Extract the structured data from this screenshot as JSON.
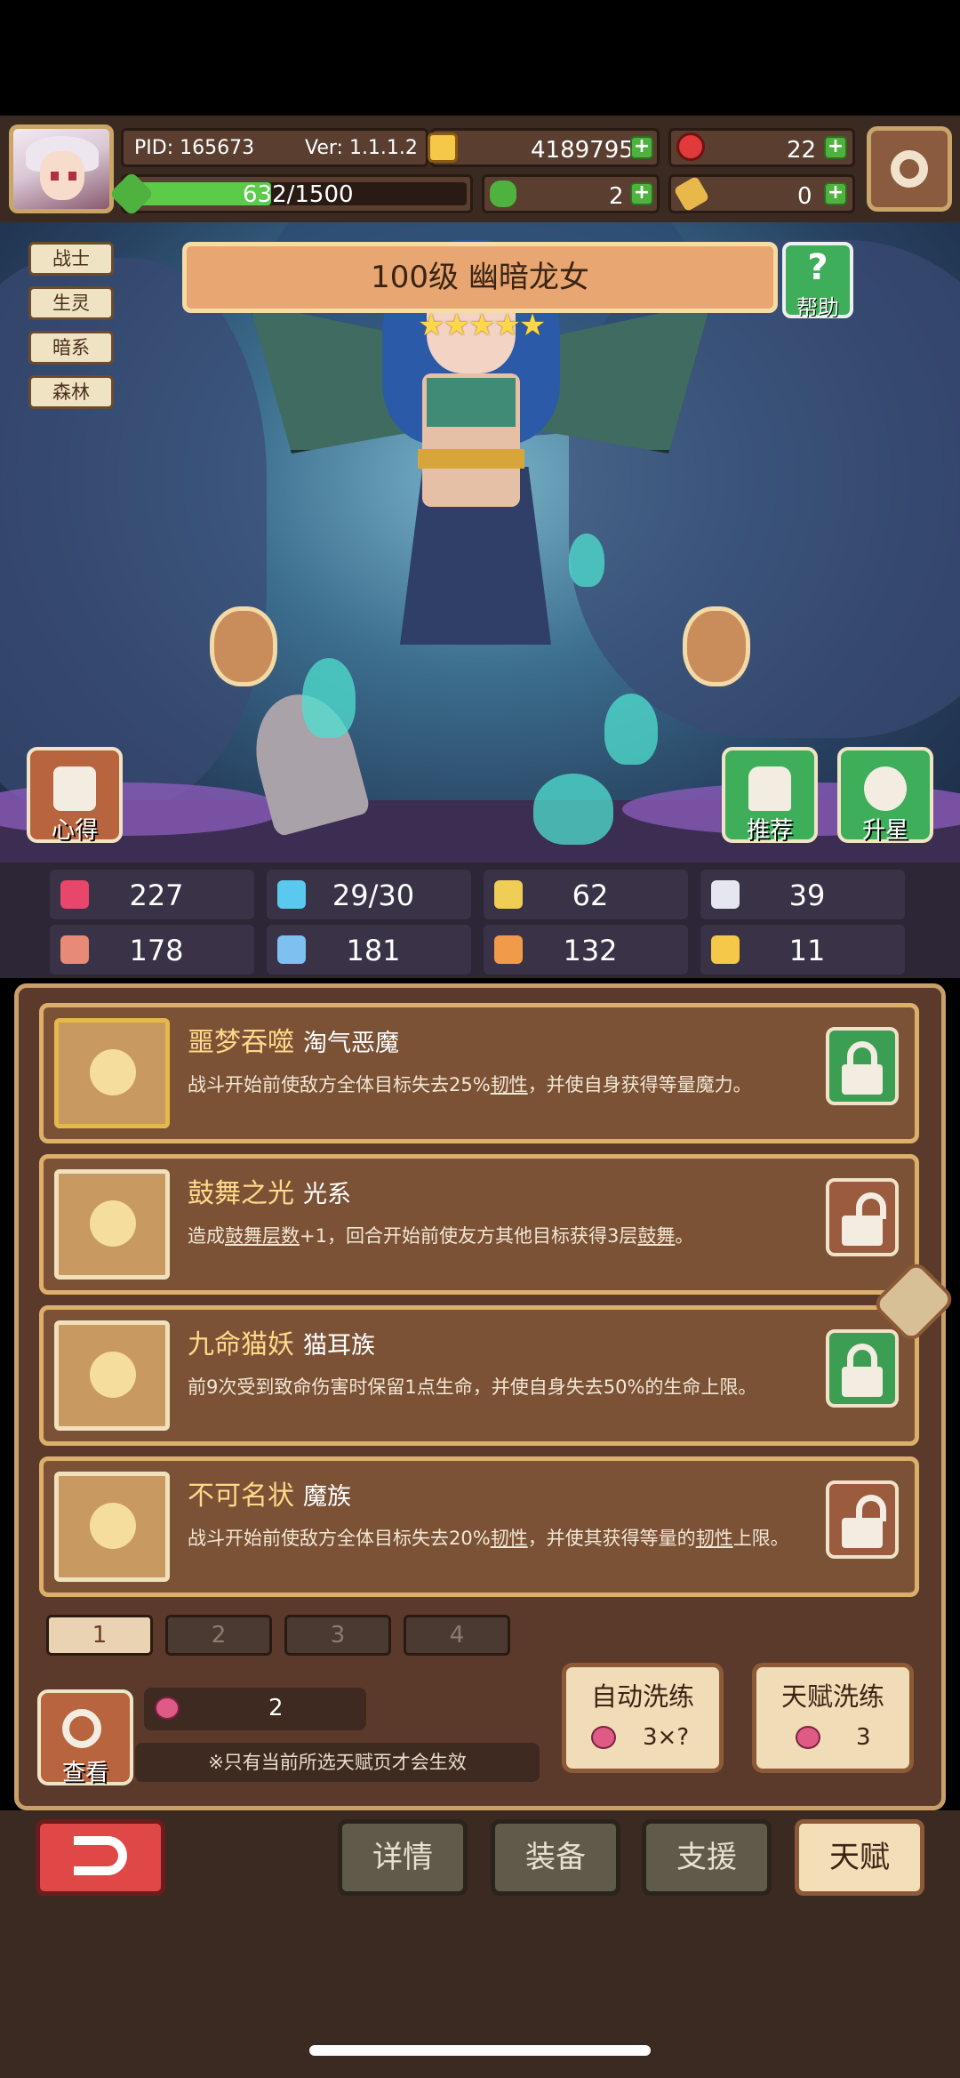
{
  "player": {
    "pid": "PID: 165673",
    "version": "Ver: 1.1.1.2",
    "exp": "632/1500",
    "exp_fraction": 0.421,
    "gold": "4189795",
    "gems": "22",
    "clover": "2",
    "scroll": "0"
  },
  "hero": {
    "tags": [
      "战士",
      "生灵",
      "暗系",
      "森林"
    ],
    "title": "100级  幽暗龙女",
    "stars_count": 5,
    "stars": "★★★★★",
    "help_label": "帮助",
    "insight_label": "心得",
    "recommend_label": "推荐",
    "upgrade_label": "升星"
  },
  "stats": [
    {
      "icon": "heart-icon",
      "value": "227",
      "color": "#e8476b"
    },
    {
      "icon": "mana-drop-icon",
      "value": "29/30",
      "color": "#5bc8f0"
    },
    {
      "icon": "shield-icon",
      "value": "62",
      "color": "#f0cd55"
    },
    {
      "icon": "wing-speed-icon",
      "value": "39",
      "color": "#e6e6f0"
    },
    {
      "icon": "fist-attack-icon",
      "value": "178",
      "color": "#e88a78"
    },
    {
      "icon": "spellbook-icon",
      "value": "181",
      "color": "#7ec0f0"
    },
    {
      "icon": "resistance-icon",
      "value": "132",
      "color": "#f09a4a"
    },
    {
      "icon": "horseshoe-icon",
      "value": "11",
      "color": "#f5c84a"
    }
  ],
  "talents": [
    {
      "name": "噩梦吞噬",
      "type": "淘气恶魔",
      "desc_pre": "战斗开始前使敌方全体目标失去25%",
      "desc_u1": "韧性",
      "desc_mid": "，并使自身获得等量魔力。",
      "desc_u2": "",
      "desc_post": "",
      "locked": true
    },
    {
      "name": "鼓舞之光",
      "type": "光系",
      "desc_pre": "造成",
      "desc_u1": "鼓舞层数",
      "desc_mid": "+1，回合开始前使友方其他目标获得3层",
      "desc_u2": "鼓舞",
      "desc_post": "。",
      "locked": false
    },
    {
      "name": "九命猫妖",
      "type": "猫耳族",
      "desc_pre": "前9次受到致命伤害时保留1点生命，并使自身失去50%的生命上限。",
      "desc_u1": "",
      "desc_mid": "",
      "desc_u2": "",
      "desc_post": "",
      "locked": true
    },
    {
      "name": "不可名状",
      "type": "魔族",
      "desc_pre": "战斗开始前使敌方全体目标失去20%",
      "desc_u1": "韧性",
      "desc_mid": "，并使其获得等量的",
      "desc_u2": "韧性",
      "desc_post": "上限。",
      "locked": false
    }
  ],
  "pages": [
    "1",
    "2",
    "3",
    "4"
  ],
  "active_page": "1",
  "reroll": {
    "view_label": "查看",
    "fruit_count": "2",
    "note": "※只有当前所选天赋页才会生效",
    "auto_label": "自动洗练",
    "auto_cost": "3×?",
    "talent_label": "天赋洗练",
    "talent_cost": "3"
  },
  "nav": {
    "details": "详情",
    "equipment": "装备",
    "support": "支援",
    "talent": "天赋"
  },
  "colors": {
    "panel": "#5b3a2c",
    "accent_gold": "#dcb06a",
    "lock_green": "#3c9e52",
    "back_red": "#e04848"
  }
}
